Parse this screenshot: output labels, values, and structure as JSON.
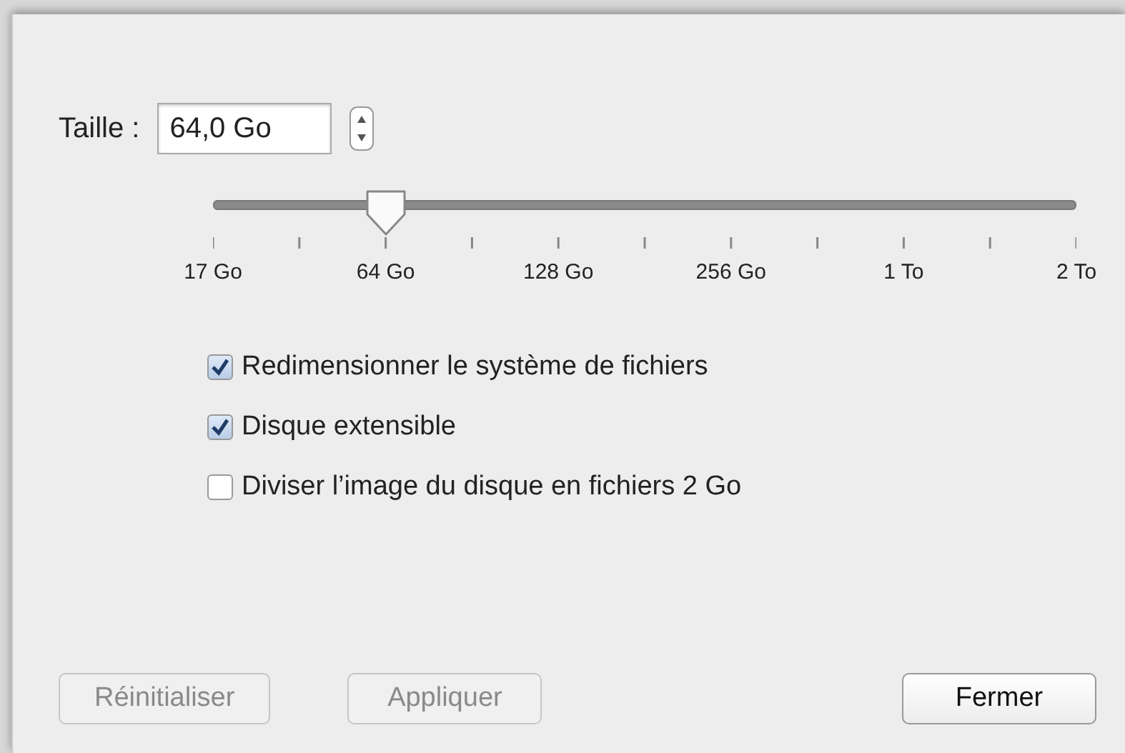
{
  "size": {
    "label": "Taille :",
    "value": "64,0 Go"
  },
  "slider": {
    "level": 0.2,
    "labels": [
      "17 Go",
      "64 Go",
      "128 Go",
      "256 Go",
      "1 To",
      "2 To"
    ]
  },
  "options": [
    {
      "label": "Redimensionner le système de fichiers",
      "checked": true
    },
    {
      "label": "Disque extensible",
      "checked": true
    },
    {
      "label": "Diviser l’image du disque en fichiers 2 Go",
      "checked": false
    }
  ],
  "buttons": [
    {
      "label": "Réinitialiser",
      "disabled": true
    },
    {
      "label": "Appliquer",
      "disabled": true
    },
    {
      "label": "Fermer",
      "disabled": false
    }
  ]
}
